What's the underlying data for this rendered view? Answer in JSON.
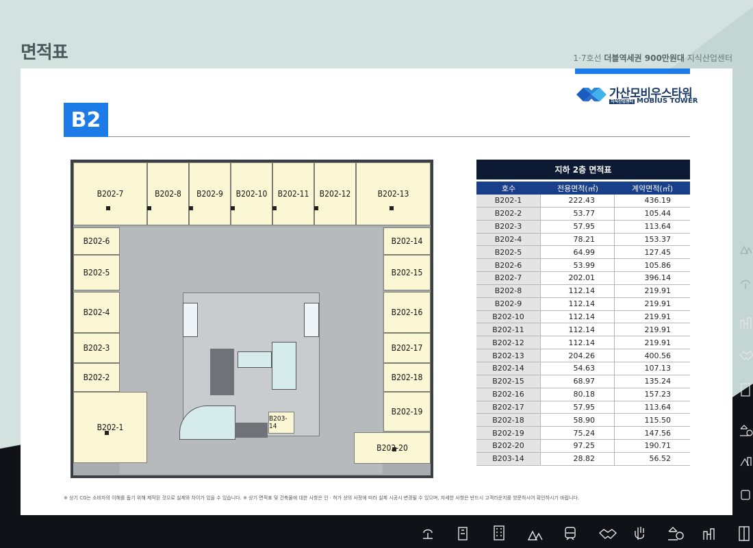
{
  "header": {
    "title": "면적표",
    "slogan_prefix": "1·7호선 ",
    "slogan_bold": "더블역세권 900만원대",
    "slogan_suffix": " 지식산업센터"
  },
  "logo": {
    "name": "가산모비우스타워",
    "badge": "지식산업센터",
    "english": "MOBIUS TOWER"
  },
  "floor_badge": "B2",
  "plan": {
    "units": [
      {
        "id": "B202-7"
      },
      {
        "id": "B202-8"
      },
      {
        "id": "B202-9"
      },
      {
        "id": "B202-10"
      },
      {
        "id": "B202-11"
      },
      {
        "id": "B202-12"
      },
      {
        "id": "B202-13"
      },
      {
        "id": "B202-6"
      },
      {
        "id": "B202-5"
      },
      {
        "id": "B202-4"
      },
      {
        "id": "B202-3"
      },
      {
        "id": "B202-2"
      },
      {
        "id": "B202-1"
      },
      {
        "id": "B202-14"
      },
      {
        "id": "B202-15"
      },
      {
        "id": "B202-16"
      },
      {
        "id": "B202-17"
      },
      {
        "id": "B202-18"
      },
      {
        "id": "B202-19"
      },
      {
        "id": "B202-20"
      },
      {
        "id": "B203-14"
      }
    ]
  },
  "table": {
    "title": "지하 2층 면적표",
    "headers": [
      "호수",
      "전용면적(㎡)",
      "계약면적(㎡)"
    ],
    "rows": [
      [
        "B202-1",
        "222.43",
        "436.19"
      ],
      [
        "B202-2",
        "53.77",
        "105.44"
      ],
      [
        "B202-3",
        "57.95",
        "113.64"
      ],
      [
        "B202-4",
        "78.21",
        "153.37"
      ],
      [
        "B202-5",
        "64.99",
        "127.45"
      ],
      [
        "B202-6",
        "53.99",
        "105.86"
      ],
      [
        "B202-7",
        "202.01",
        "396.14"
      ],
      [
        "B202-8",
        "112.14",
        "219.91"
      ],
      [
        "B202-9",
        "112.14",
        "219.91"
      ],
      [
        "B202-10",
        "112.14",
        "219.91"
      ],
      [
        "B202-11",
        "112.14",
        "219.91"
      ],
      [
        "B202-12",
        "112.14",
        "219.91"
      ],
      [
        "B202-13",
        "204.26",
        "400.56"
      ],
      [
        "B202-14",
        "54.63",
        "107.13"
      ],
      [
        "B202-15",
        "68.97",
        "135.24"
      ],
      [
        "B202-16",
        "80.18",
        "157.23"
      ],
      [
        "B202-17",
        "57.95",
        "113.64"
      ],
      [
        "B202-18",
        "58.90",
        "115.50"
      ],
      [
        "B202-19",
        "75.24",
        "147.56"
      ],
      [
        "B202-20",
        "97.25",
        "190.71"
      ],
      [
        "B203-14",
        "28.82",
        "56.52"
      ]
    ]
  },
  "footnote": "※ 상기 CG는 소비자의 이해를 돕기 위해 제작된 것으로 실제와 차이가 있을 수 있습니다. ※ 상기 면적표 및 건축물에 대한 사항은 인 · 허가 상의 사정에 따라 실제 시공시 변경될 수 있으며, 자세한 사항은 반드시 고객라운지를 방문하시어 확인하시기 바랍니다.",
  "icons": {
    "bottom": [
      "tree-icon",
      "phone-icon",
      "building-icon",
      "forest-icon",
      "subway-icon",
      "handshake-icon",
      "hand-icon",
      "bank-icon",
      "city-icon",
      "elevator-icon"
    ],
    "side": [
      "forest-icon",
      "tree-icon",
      "city-icon",
      "handshake-icon",
      "building-icon",
      "bank-icon",
      "city-icon",
      "subway-icon"
    ]
  },
  "colors": {
    "accent": "#1c7be6",
    "navy": "#0d1a33",
    "unit_fill": "#fbf6d3",
    "background": "#d3e1df"
  }
}
